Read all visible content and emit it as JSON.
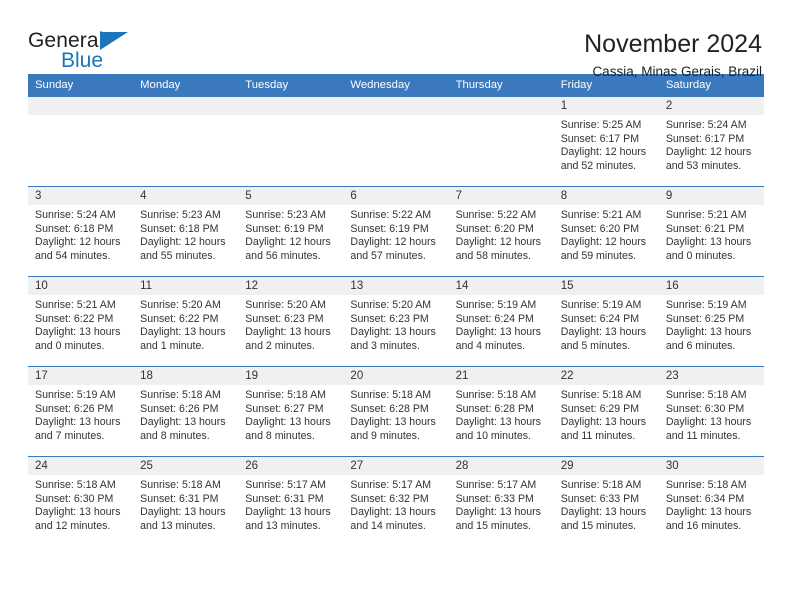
{
  "brand": {
    "name_part1": "General",
    "name_part2": "Blue",
    "logo_icon": "triangle-icon",
    "accent_color": "#1b75bb"
  },
  "header": {
    "title": "November 2024",
    "subtitle": "Cassia, Minas Gerais, Brazil"
  },
  "calendar": {
    "header_bg": "#3a79bd",
    "daynum_bg": "#f0f0f0",
    "weekdays": [
      "Sunday",
      "Monday",
      "Tuesday",
      "Wednesday",
      "Thursday",
      "Friday",
      "Saturday"
    ],
    "labels": {
      "sunrise": "Sunrise:",
      "sunset": "Sunset:",
      "daylight": "Daylight:"
    },
    "weeks": [
      [
        {
          "day": ""
        },
        {
          "day": ""
        },
        {
          "day": ""
        },
        {
          "day": ""
        },
        {
          "day": ""
        },
        {
          "day": "1",
          "sunrise": "Sunrise: 5:25 AM",
          "sunset": "Sunset: 6:17 PM",
          "daylight_l1": "Daylight: 12 hours",
          "daylight_l2": "and 52 minutes."
        },
        {
          "day": "2",
          "sunrise": "Sunrise: 5:24 AM",
          "sunset": "Sunset: 6:17 PM",
          "daylight_l1": "Daylight: 12 hours",
          "daylight_l2": "and 53 minutes."
        }
      ],
      [
        {
          "day": "3",
          "sunrise": "Sunrise: 5:24 AM",
          "sunset": "Sunset: 6:18 PM",
          "daylight_l1": "Daylight: 12 hours",
          "daylight_l2": "and 54 minutes."
        },
        {
          "day": "4",
          "sunrise": "Sunrise: 5:23 AM",
          "sunset": "Sunset: 6:18 PM",
          "daylight_l1": "Daylight: 12 hours",
          "daylight_l2": "and 55 minutes."
        },
        {
          "day": "5",
          "sunrise": "Sunrise: 5:23 AM",
          "sunset": "Sunset: 6:19 PM",
          "daylight_l1": "Daylight: 12 hours",
          "daylight_l2": "and 56 minutes."
        },
        {
          "day": "6",
          "sunrise": "Sunrise: 5:22 AM",
          "sunset": "Sunset: 6:19 PM",
          "daylight_l1": "Daylight: 12 hours",
          "daylight_l2": "and 57 minutes."
        },
        {
          "day": "7",
          "sunrise": "Sunrise: 5:22 AM",
          "sunset": "Sunset: 6:20 PM",
          "daylight_l1": "Daylight: 12 hours",
          "daylight_l2": "and 58 minutes."
        },
        {
          "day": "8",
          "sunrise": "Sunrise: 5:21 AM",
          "sunset": "Sunset: 6:20 PM",
          "daylight_l1": "Daylight: 12 hours",
          "daylight_l2": "and 59 minutes."
        },
        {
          "day": "9",
          "sunrise": "Sunrise: 5:21 AM",
          "sunset": "Sunset: 6:21 PM",
          "daylight_l1": "Daylight: 13 hours",
          "daylight_l2": "and 0 minutes."
        }
      ],
      [
        {
          "day": "10",
          "sunrise": "Sunrise: 5:21 AM",
          "sunset": "Sunset: 6:22 PM",
          "daylight_l1": "Daylight: 13 hours",
          "daylight_l2": "and 0 minutes."
        },
        {
          "day": "11",
          "sunrise": "Sunrise: 5:20 AM",
          "sunset": "Sunset: 6:22 PM",
          "daylight_l1": "Daylight: 13 hours",
          "daylight_l2": "and 1 minute."
        },
        {
          "day": "12",
          "sunrise": "Sunrise: 5:20 AM",
          "sunset": "Sunset: 6:23 PM",
          "daylight_l1": "Daylight: 13 hours",
          "daylight_l2": "and 2 minutes."
        },
        {
          "day": "13",
          "sunrise": "Sunrise: 5:20 AM",
          "sunset": "Sunset: 6:23 PM",
          "daylight_l1": "Daylight: 13 hours",
          "daylight_l2": "and 3 minutes."
        },
        {
          "day": "14",
          "sunrise": "Sunrise: 5:19 AM",
          "sunset": "Sunset: 6:24 PM",
          "daylight_l1": "Daylight: 13 hours",
          "daylight_l2": "and 4 minutes."
        },
        {
          "day": "15",
          "sunrise": "Sunrise: 5:19 AM",
          "sunset": "Sunset: 6:24 PM",
          "daylight_l1": "Daylight: 13 hours",
          "daylight_l2": "and 5 minutes."
        },
        {
          "day": "16",
          "sunrise": "Sunrise: 5:19 AM",
          "sunset": "Sunset: 6:25 PM",
          "daylight_l1": "Daylight: 13 hours",
          "daylight_l2": "and 6 minutes."
        }
      ],
      [
        {
          "day": "17",
          "sunrise": "Sunrise: 5:19 AM",
          "sunset": "Sunset: 6:26 PM",
          "daylight_l1": "Daylight: 13 hours",
          "daylight_l2": "and 7 minutes."
        },
        {
          "day": "18",
          "sunrise": "Sunrise: 5:18 AM",
          "sunset": "Sunset: 6:26 PM",
          "daylight_l1": "Daylight: 13 hours",
          "daylight_l2": "and 8 minutes."
        },
        {
          "day": "19",
          "sunrise": "Sunrise: 5:18 AM",
          "sunset": "Sunset: 6:27 PM",
          "daylight_l1": "Daylight: 13 hours",
          "daylight_l2": "and 8 minutes."
        },
        {
          "day": "20",
          "sunrise": "Sunrise: 5:18 AM",
          "sunset": "Sunset: 6:28 PM",
          "daylight_l1": "Daylight: 13 hours",
          "daylight_l2": "and 9 minutes."
        },
        {
          "day": "21",
          "sunrise": "Sunrise: 5:18 AM",
          "sunset": "Sunset: 6:28 PM",
          "daylight_l1": "Daylight: 13 hours",
          "daylight_l2": "and 10 minutes."
        },
        {
          "day": "22",
          "sunrise": "Sunrise: 5:18 AM",
          "sunset": "Sunset: 6:29 PM",
          "daylight_l1": "Daylight: 13 hours",
          "daylight_l2": "and 11 minutes."
        },
        {
          "day": "23",
          "sunrise": "Sunrise: 5:18 AM",
          "sunset": "Sunset: 6:30 PM",
          "daylight_l1": "Daylight: 13 hours",
          "daylight_l2": "and 11 minutes."
        }
      ],
      [
        {
          "day": "24",
          "sunrise": "Sunrise: 5:18 AM",
          "sunset": "Sunset: 6:30 PM",
          "daylight_l1": "Daylight: 13 hours",
          "daylight_l2": "and 12 minutes."
        },
        {
          "day": "25",
          "sunrise": "Sunrise: 5:18 AM",
          "sunset": "Sunset: 6:31 PM",
          "daylight_l1": "Daylight: 13 hours",
          "daylight_l2": "and 13 minutes."
        },
        {
          "day": "26",
          "sunrise": "Sunrise: 5:17 AM",
          "sunset": "Sunset: 6:31 PM",
          "daylight_l1": "Daylight: 13 hours",
          "daylight_l2": "and 13 minutes."
        },
        {
          "day": "27",
          "sunrise": "Sunrise: 5:17 AM",
          "sunset": "Sunset: 6:32 PM",
          "daylight_l1": "Daylight: 13 hours",
          "daylight_l2": "and 14 minutes."
        },
        {
          "day": "28",
          "sunrise": "Sunrise: 5:17 AM",
          "sunset": "Sunset: 6:33 PM",
          "daylight_l1": "Daylight: 13 hours",
          "daylight_l2": "and 15 minutes."
        },
        {
          "day": "29",
          "sunrise": "Sunrise: 5:18 AM",
          "sunset": "Sunset: 6:33 PM",
          "daylight_l1": "Daylight: 13 hours",
          "daylight_l2": "and 15 minutes."
        },
        {
          "day": "30",
          "sunrise": "Sunrise: 5:18 AM",
          "sunset": "Sunset: 6:34 PM",
          "daylight_l1": "Daylight: 13 hours",
          "daylight_l2": "and 16 minutes."
        }
      ]
    ]
  }
}
